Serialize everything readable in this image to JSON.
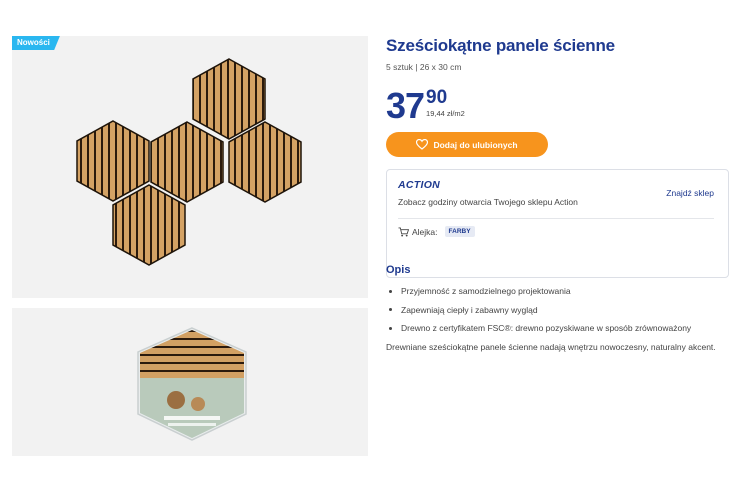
{
  "product": {
    "badge": "Nowości",
    "title": "Sześciokątne panele ścienne",
    "subtitle": "5 sztuk | 26 x 30 cm",
    "price_whole": "37",
    "price_cents": "90",
    "unit_price": "19,44 zł/m2"
  },
  "actions": {
    "favorite_label": "Dodaj do ulubionych"
  },
  "store": {
    "logo_text": "ACTION",
    "find_store_label": "Znajdź sklep",
    "opening_text": "Zobacz godziny otwarcia Twojego sklepu Action",
    "aisle_label": "Alejka:",
    "aisle_value": "FARBY"
  },
  "description": {
    "heading": "Opis",
    "features": [
      "Przyjemność z samodzielnego projektowania",
      "Zapewniają ciepły i zabawny wygląd",
      "Drewno z certyfikatem FSC®: drewno pozyskiwane w sposób zrównoważony"
    ],
    "text": "Drewniane sześciokątne panele ścienne nadają wnętrzu nowoczesny, naturalny akcent."
  },
  "colors": {
    "brand_blue": "#1f3a8f",
    "accent_orange": "#f7941d",
    "badge_blue": "#2ab7f0"
  },
  "icons": {
    "favorite": "heart-icon",
    "aisle": "cart-icon"
  }
}
